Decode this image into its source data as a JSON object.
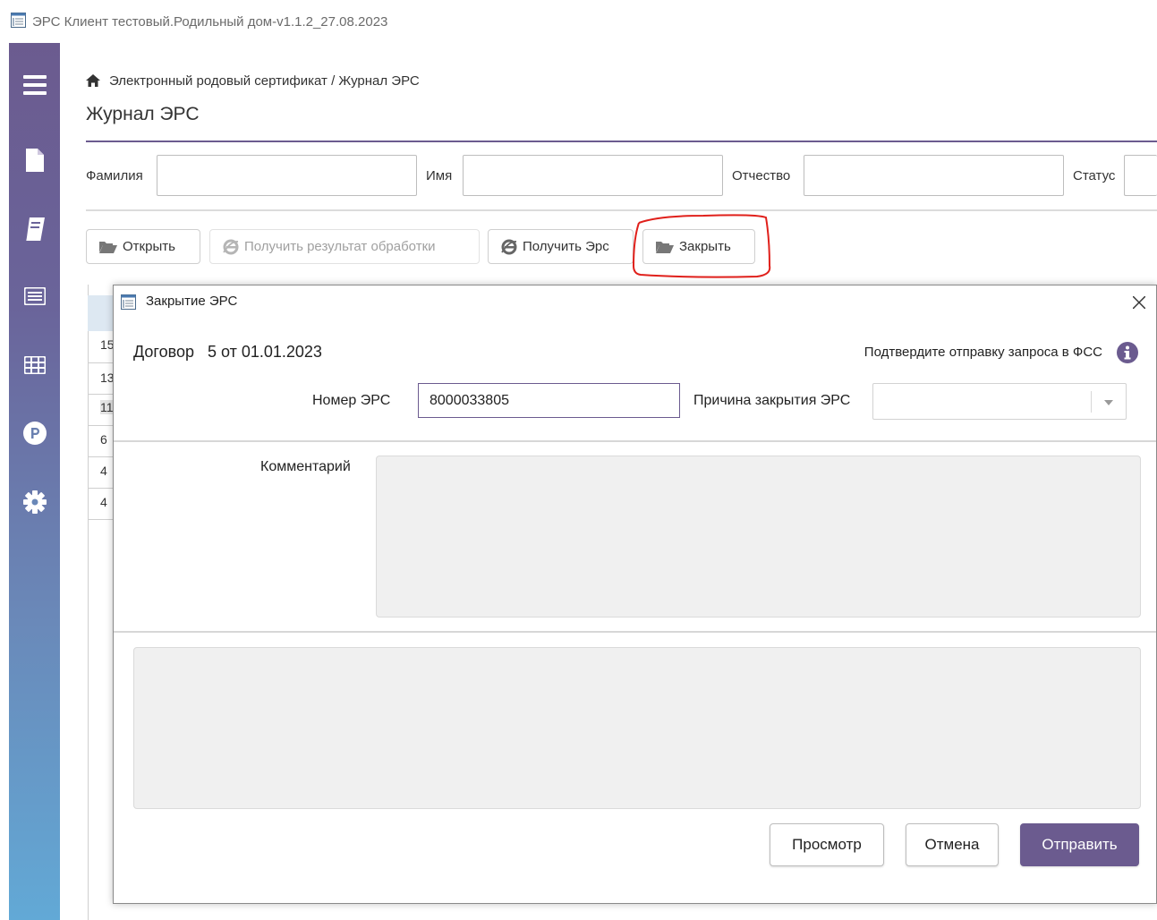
{
  "window": {
    "title": "ЭРС Клиент тестовый.Родильный дом-v1.1.2_27.08.2023"
  },
  "breadcrumb": {
    "path": "Электронный родовый сертификат / Журнал ЭРС"
  },
  "page": {
    "title": "Журнал ЭРС"
  },
  "filters": {
    "surname_label": "Фамилия",
    "surname_value": "",
    "name_label": "Имя",
    "name_value": "",
    "patronymic_label": "Отчество",
    "patronymic_value": "",
    "status_label": "Статус",
    "status_value": ""
  },
  "toolbar": {
    "open_label": "Открыть",
    "get_result_label": "Получить результат обработки",
    "get_ers_label": "Получить Эрс",
    "close_label": "Закрыть"
  },
  "grid": {
    "visible_cells": [
      "15",
      "13",
      "11",
      "6",
      "4",
      "4"
    ]
  },
  "dialog": {
    "title": "Закрытие ЭРС",
    "contract": "Договор   5 от 01.01.2023",
    "confirm_text": "Подтвердите отправку запроса в ФСС",
    "ers_number_label": "Номер ЭРС",
    "ers_number_value": "8000033805",
    "close_reason_label": "Причина закрытия ЭРС",
    "close_reason_value": "",
    "comment_label": "Комментарий",
    "comment_value": "",
    "output_value": "",
    "preview_label": "Просмотр",
    "cancel_label": "Отмена",
    "send_label": "Отправить"
  },
  "colors": {
    "accent": "#6b5b8f",
    "sidebar_bottom": "#62a9d6",
    "highlight": "#e0201b"
  }
}
